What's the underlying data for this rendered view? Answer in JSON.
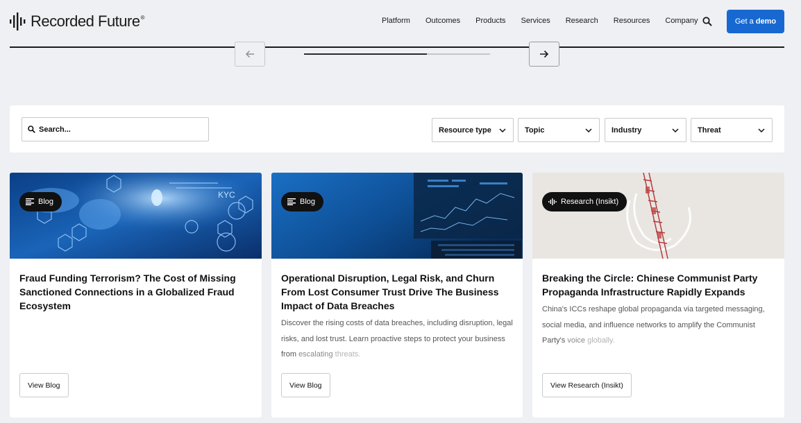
{
  "header": {
    "logo_text": "Recorded Future",
    "logo_reg": "®",
    "nav": [
      "Platform",
      "Outcomes",
      "Products",
      "Services",
      "Research",
      "Resources",
      "Company"
    ],
    "demo_prefix": "Get a",
    "demo_bold": "demo"
  },
  "carousel": {
    "progress_fraction": 0.66
  },
  "filters": {
    "search_placeholder": "Search...",
    "dropdowns": [
      "Resource type",
      "Topic",
      "Industry",
      "Threat"
    ]
  },
  "cards": [
    {
      "badge": "Blog",
      "title": "Fraud Funding Terrorism? The Cost of Missing Sanctioned Connections in a Globalized Fraud Ecosystem",
      "description": "",
      "button": "View Blog"
    },
    {
      "badge": "Blog",
      "title": "Operational Disruption, Legal Risk, and Churn From Lost Consumer Trust Drive The Business Impact of Data Breaches",
      "description_main": "Discover the rising costs of data breaches, including disruption, legal risks, and lost trust. Learn proactive steps to protect your business from ",
      "description_fade1": "escalating ",
      "description_fade2": "threats.",
      "button": "View Blog"
    },
    {
      "badge": "Research (Insikt)",
      "title": "Breaking the Circle: Chinese Communist Party Propaganda Infrastructure Rapidly Expands",
      "description_main": "China's ICCs reshape global propaganda via targeted messaging, social media, and influence networks to amplify the Communist Party's ",
      "description_fade1": "voice ",
      "description_fade2": "globally.",
      "button": "View Research (Insikt)"
    }
  ],
  "colors": {
    "accent": "#1769d1",
    "page_bg": "#eef0f3"
  }
}
